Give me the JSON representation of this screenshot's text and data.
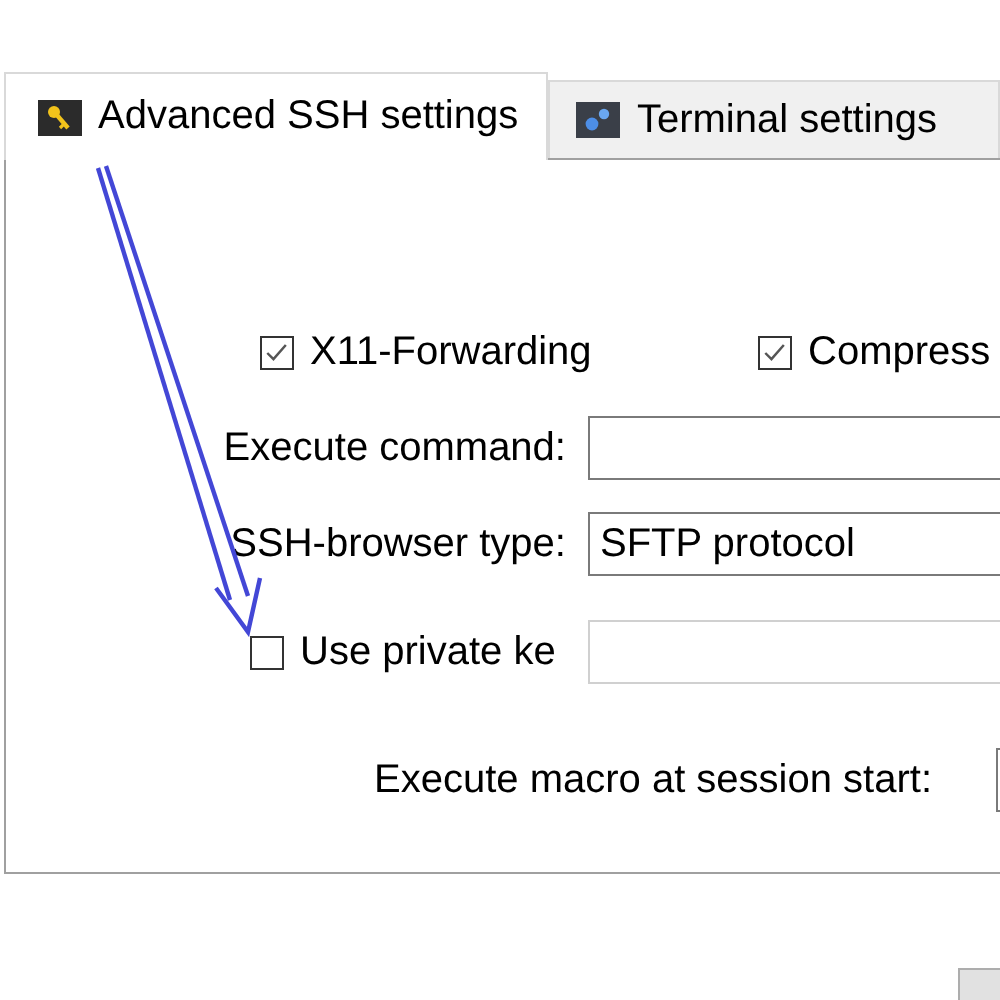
{
  "tabs": [
    {
      "label": "Advanced SSH settings",
      "selected": true
    },
    {
      "label": "Terminal settings",
      "selected": false
    }
  ],
  "checkboxes": [
    {
      "label": "X11-Forwarding",
      "checked": true
    },
    {
      "label": "Compress",
      "checked": true
    }
  ],
  "execute_command": {
    "label": "Execute command:"
  },
  "ssh_browser_type": {
    "label": "SSH-browser type:",
    "value": "SFTP protocol"
  },
  "private_key": {
    "label": "Use private ke",
    "checked": false
  },
  "macro": {
    "label": "Execute macro at session start:"
  }
}
